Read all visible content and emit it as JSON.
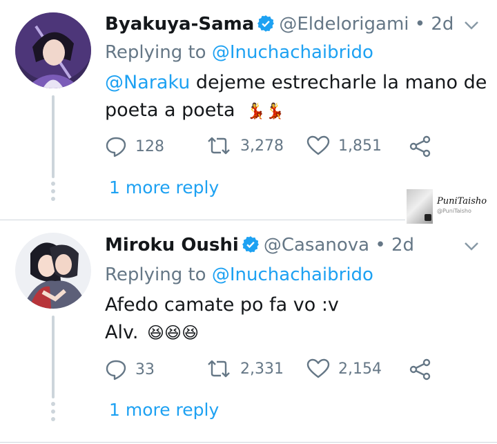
{
  "colors": {
    "link": "#1da1f2",
    "muted": "#657786",
    "verified": "#1da1f2",
    "divider": "#cfd6dc"
  },
  "tweets": [
    {
      "name": "Byakuya-Sama",
      "handle": "@Eldelorigami",
      "separator": "•",
      "time": "2d",
      "replying_prefix": "Replying to",
      "replying_handle": "@Inuchachaibrido",
      "mention": "@Naraku",
      "text_line1": " dejeme estrecharle la mano de",
      "text_line2": "poeta a poeta",
      "emoji": "💃💃",
      "replies": "128",
      "retweets": "3,278",
      "likes": "1,851",
      "more_reply": "1 more reply"
    },
    {
      "name": "Miroku Oushi",
      "handle": "@Casanova",
      "separator": "•",
      "time": "2d",
      "replying_prefix": "Replying to",
      "replying_handle": "@Inuchachaibrido",
      "text_line1": "Afedo camate po fa vo :v",
      "text_line2": "Alv.",
      "emoji": "😆😆😆",
      "replies": "33",
      "retweets": "2,331",
      "likes": "2,154",
      "more_reply": "1 more reply"
    }
  ],
  "watermark": {
    "name": "PuniTaisho",
    "handle": "@PuniTaisho"
  }
}
